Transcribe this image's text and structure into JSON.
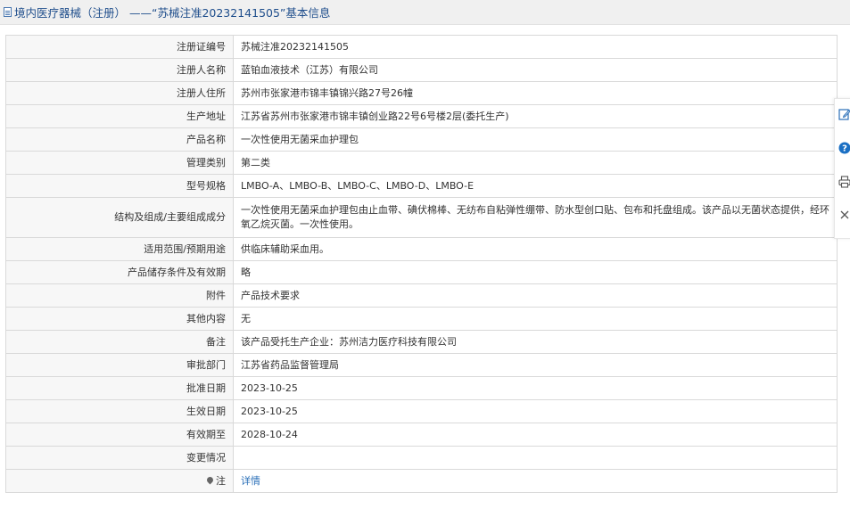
{
  "header": {
    "title": "境内医疗器械（注册） ——“苏械注准20232141505”基本信息"
  },
  "rows": [
    {
      "label": "注册证编号",
      "value": "苏械注准20232141505"
    },
    {
      "label": "注册人名称",
      "value": "蓝铂血液技术（江苏）有限公司"
    },
    {
      "label": "注册人住所",
      "value": "苏州市张家港市锦丰镇锦兴路27号26幢"
    },
    {
      "label": "生产地址",
      "value": "江苏省苏州市张家港市锦丰镇创业路22号6号楼2层(委托生产)"
    },
    {
      "label": "产品名称",
      "value": "一次性使用无菌采血护理包"
    },
    {
      "label": "管理类别",
      "value": "第二类"
    },
    {
      "label": "型号规格",
      "value": "LMBO-A、LMBO-B、LMBO-C、LMBO-D、LMBO-E"
    },
    {
      "label": "结构及组成/主要组成成分",
      "value": "一次性使用无菌采血护理包由止血带、碘伏棉棒、无纺布自粘弹性绷带、防水型创口贴、包布和托盘组成。该产品以无菌状态提供，经环氧乙烷灭菌。一次性使用。"
    },
    {
      "label": "适用范围/预期用途",
      "value": "供临床辅助采血用。"
    },
    {
      "label": "产品储存条件及有效期",
      "value": "略"
    },
    {
      "label": "附件",
      "value": "产品技术要求"
    },
    {
      "label": "其他内容",
      "value": "无"
    },
    {
      "label": "备注",
      "value": "该产品受托生产企业：苏州洁力医疗科技有限公司"
    },
    {
      "label": "审批部门",
      "value": "江苏省药品监督管理局"
    },
    {
      "label": "批准日期",
      "value": "2023-10-25"
    },
    {
      "label": "生效日期",
      "value": "2023-10-25"
    },
    {
      "label": "有效期至",
      "value": "2028-10-24"
    },
    {
      "label": "变更情况",
      "value": ""
    },
    {
      "label": "注",
      "value": "详情"
    }
  ],
  "side_tools": [
    "edit-icon",
    "help-icon",
    "print-icon",
    "close-icon"
  ],
  "colors": {
    "link": "#2a6fb8",
    "title": "#1f4e8c",
    "help": "#1a6fc4"
  }
}
